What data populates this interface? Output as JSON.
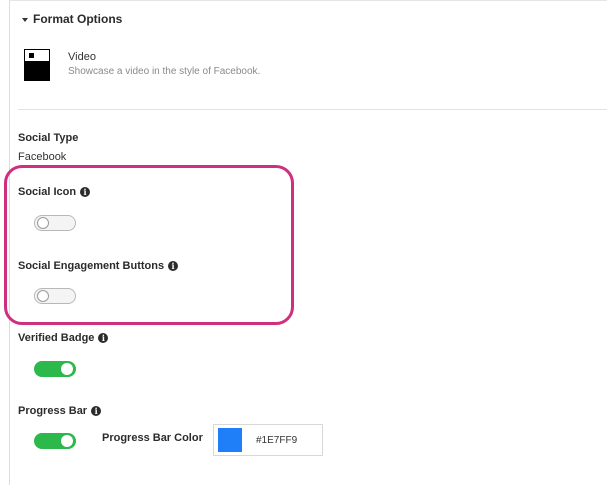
{
  "format_options": {
    "header": "Format Options",
    "item_title": "Video",
    "item_description": "Showcase a video in the style of Facebook."
  },
  "social_type": {
    "label": "Social Type",
    "value": "Facebook"
  },
  "social_icon": {
    "label": "Social Icon",
    "enabled": false
  },
  "social_engagement": {
    "label": "Social Engagement Buttons",
    "enabled": false
  },
  "verified_badge": {
    "label": "Verified Badge",
    "enabled": true
  },
  "progress_bar": {
    "label": "Progress Bar",
    "enabled": true,
    "color_label": "Progress Bar Color",
    "color_hex": "#1E7FF9"
  },
  "colors": {
    "toggle_on": "#2db84b",
    "highlight": "#cf2f7e",
    "progress_color": "#1E7FF9"
  }
}
